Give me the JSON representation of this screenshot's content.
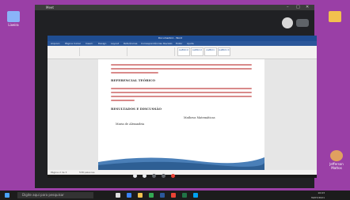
{
  "desktop": {
    "icons": [
      {
        "name": "recycle-bin",
        "label": "Lixeira",
        "color": "#8ab4f8"
      },
      {
        "name": "folder",
        "label": "",
        "color": "#f2c14e"
      },
      {
        "name": "user-folder",
        "label": "Jefferson Mattos",
        "color": "#e0a060"
      }
    ]
  },
  "meet": {
    "title": "Meet",
    "controls": [
      "–",
      "□",
      "✕"
    ]
  },
  "word": {
    "title": "Documento1 - Word",
    "tabs": [
      "Arquivo",
      "Página Inicial",
      "Inserir",
      "Design",
      "Layout",
      "Referências",
      "Correspondências",
      "Revisão",
      "Exibir",
      "Ajuda"
    ],
    "styles": [
      "AaBbCcI",
      "AaBbCcI",
      "AaBbCc",
      "AaBbCcC"
    ],
    "style_names": [
      "Normal",
      "Sem Esp.",
      "Título 1",
      "Título 2"
    ]
  },
  "document": {
    "heading1": "REFERENCIAL TEÓRICO",
    "heading2": "RESULTADOS E DISCUSSÃO",
    "table_col1": "Maria de Alexandria",
    "table_col2": "Matheus Matemáticas"
  },
  "statusbar": {
    "page": "Página 2 de 3",
    "words": "538 palavras"
  },
  "taskbar": {
    "search_placeholder": "Digite aqui para pesquisar",
    "time": "10:03",
    "date": "30/07/2021"
  }
}
